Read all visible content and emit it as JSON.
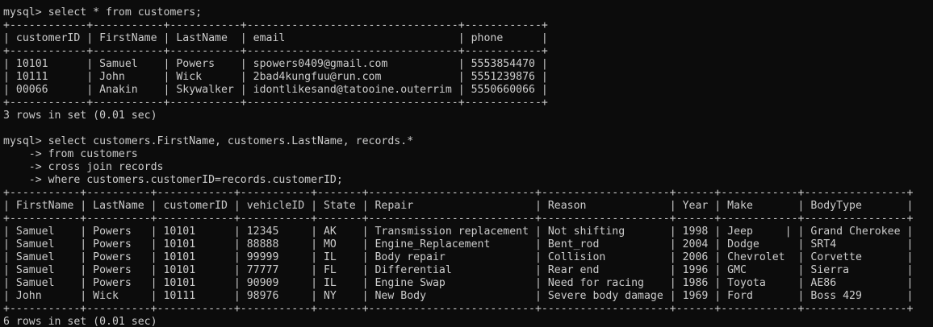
{
  "terminal": {
    "fg_color": "#cccccc",
    "bg_color": "#0c0c0c",
    "lines": [
      "",
      "mysql> select * from customers;",
      "+------------+-----------+-----------+---------------------------------+------------+",
      "| customerID | FirstName | LastName  | email                           | phone      |",
      "+------------+-----------+-----------+---------------------------------+------------+",
      "| 10101      | Samuel    | Powers    | spowers0409@gmail.com           | 5553854470 |",
      "| 10111      | John      | Wick      | 2bad4kungfuu@run.com            | 5551239876 |",
      "| 00066      | Anakin    | Skywalker | idontlikesand@tatooine.outerrim | 5550660066 |",
      "+------------+-----------+-----------+---------------------------------+------------+",
      "3 rows in set (0.01 sec)",
      "",
      "mysql> select customers.FirstName, customers.LastName, records.*",
      "    -> from customers",
      "    -> cross join records",
      "    -> where customers.customerID=records.customerID;",
      "+-----------+----------+------------+-----------+-------+--------------------------+--------------------+------+------------+----------------+",
      "| FirstName | LastName | customerID | vehicleID | State | Repair                   | Reason             | Year | Make       | BodyType       |",
      "+-----------+----------+------------+-----------+-------+--------------------------+--------------------+------+------------+----------------+",
      "| Samuel    | Powers   | 10101      | 12345     | AK    | Transmission replacement | Not shifting       | 1998 | Jeep     | | Grand Cherokee |",
      "| Samuel    | Powers   | 10101      | 88888     | MO    | Engine_Replacement       | Bent_rod           | 2004 | Dodge      | SRT4           |",
      "| Samuel    | Powers   | 10101      | 99999     | IL    | Body repair              | Collision          | 2006 | Chevrolet  | Corvette       |",
      "| Samuel    | Powers   | 10101      | 77777     | FL    | Differential             | Rear end           | 1996 | GMC        | Sierra         |",
      "| Samuel    | Powers   | 10101      | 90909     | IL    | Engine Swap              | Need for racing    | 1986 | Toyota     | AE86           |",
      "| John      | Wick     | 10111      | 98976     | NY    | New Body                 | Severe body damage | 1969 | Ford       | Boss 429       |",
      "+-----------+----------+------------+-----------+-------+--------------------------+--------------------+------+------------+----------------+",
      "6 rows in set (0.01 sec)"
    ]
  }
}
